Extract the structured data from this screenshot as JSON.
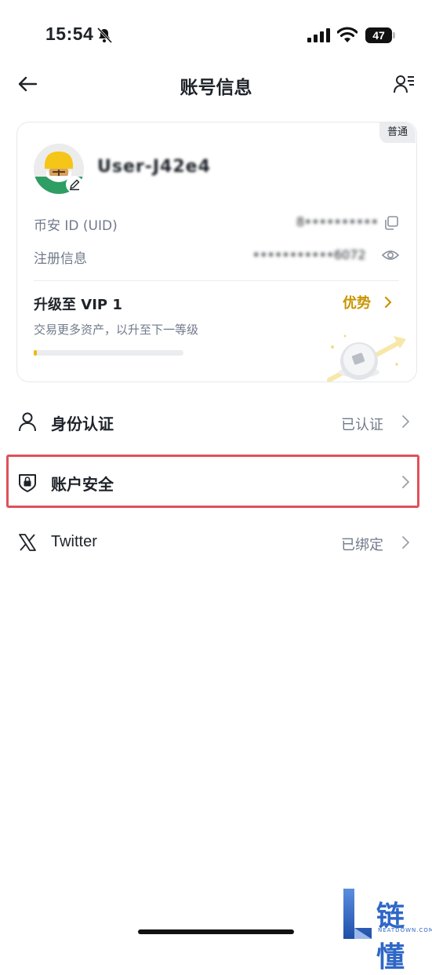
{
  "status_bar": {
    "time": "15:54",
    "battery": "47"
  },
  "header": {
    "title": "账号信息"
  },
  "account_card": {
    "badge": "普通",
    "nickname": "User-J42e4",
    "uid_label": "币安 ID (UID)",
    "uid_value": "8••••••••••",
    "registration_label": "注册信息",
    "registration_value": "•••••••••••6072",
    "vip_title": "升级至 VIP 1",
    "vip_link": "优势",
    "vip_desc": "交易更多资产，以升至下一等级",
    "vip_progress": 0.02
  },
  "menu": [
    {
      "label": "身份认证",
      "status": "已认证",
      "icon": "user-icon"
    },
    {
      "label": "账户安全",
      "status": "",
      "icon": "shield-lock-icon",
      "highlighted": true
    },
    {
      "label": "Twitter",
      "status": "已绑定",
      "icon": "x-logo-icon"
    }
  ],
  "watermark": {
    "text": "链懂",
    "sub": "NEATDOWN.COM"
  },
  "colors": {
    "accent": "#f0b90b",
    "highlight_border": "#e0505a",
    "watermark": "#2f67c7"
  }
}
